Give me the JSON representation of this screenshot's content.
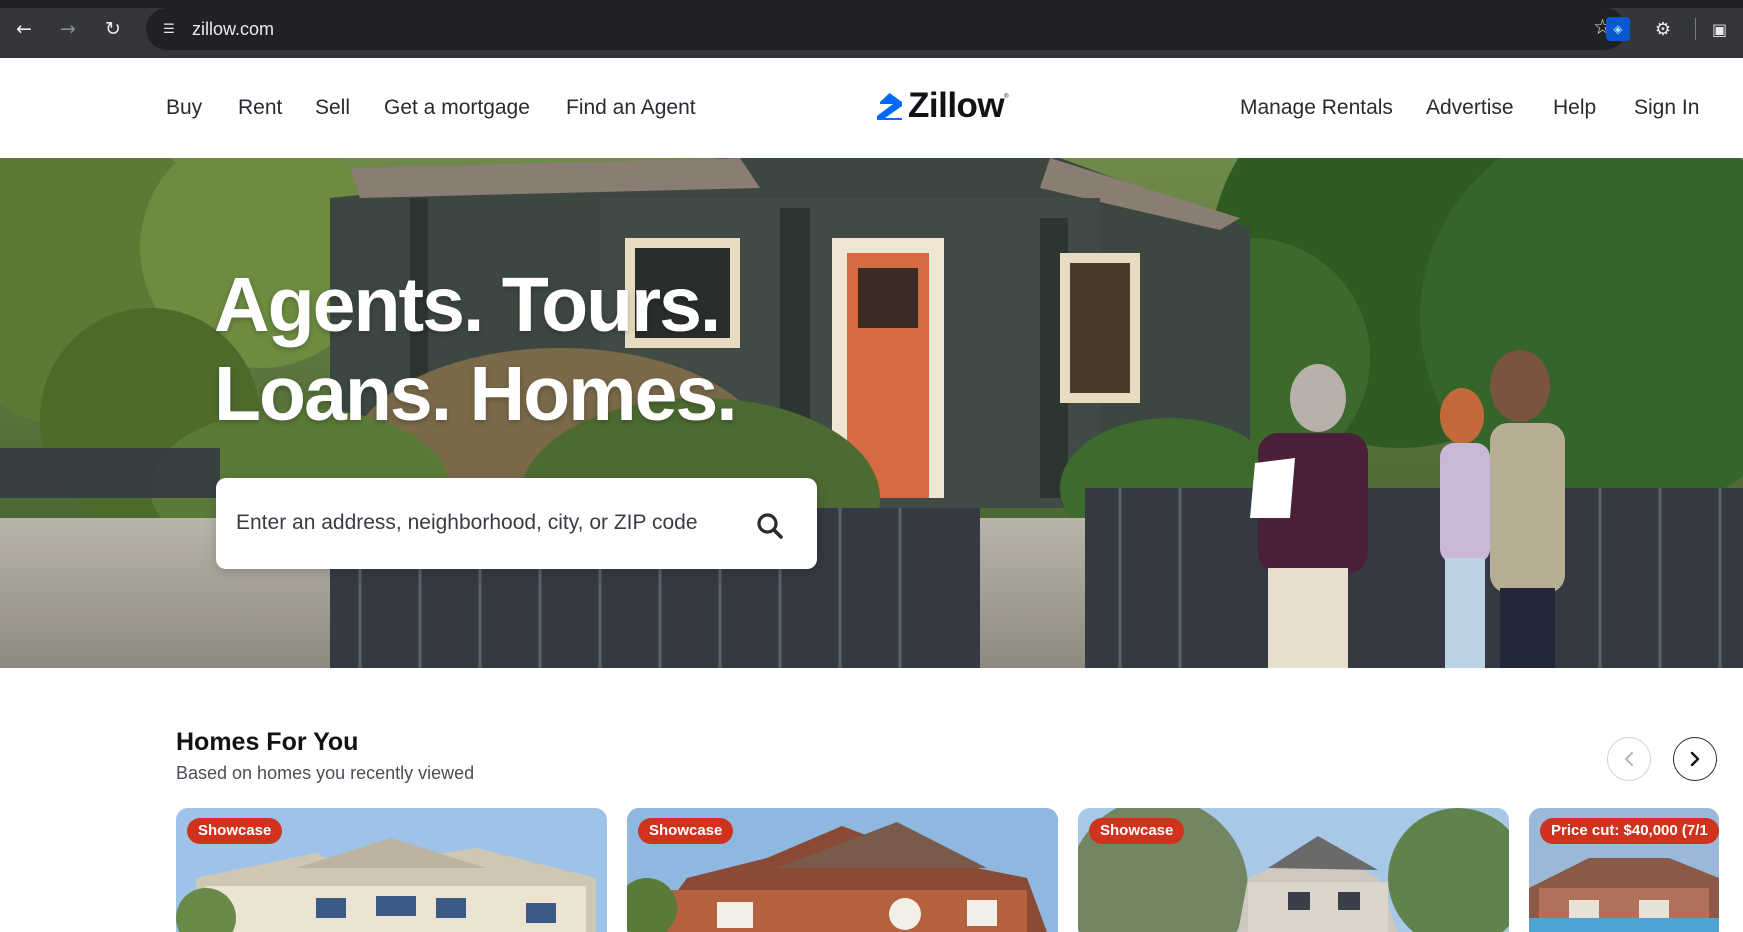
{
  "browser": {
    "url": "zillow.com",
    "back_icon": "arrow-left-icon",
    "forward_icon": "arrow-right-icon",
    "reload_icon": "reload-icon",
    "site_info_icon": "tune-icon",
    "bookmark_icon": "star-icon",
    "extensions_icon": "puzzle-icon"
  },
  "header": {
    "left_nav": [
      "Buy",
      "Rent",
      "Sell",
      "Get a mortgage",
      "Find an Agent"
    ],
    "logo_text": "Zillow",
    "right_nav": [
      "Manage Rentals",
      "Advertise",
      "Help",
      "Sign In"
    ]
  },
  "hero": {
    "title_line1": "Agents. Tours.",
    "title_line2": "Loans. Homes.",
    "search_placeholder": "Enter an address, neighborhood, city, or ZIP code",
    "search_icon": "search-icon"
  },
  "homes_for_you": {
    "title": "Homes For You",
    "subtitle": "Based on homes you recently viewed",
    "prev_icon": "chevron-left-icon",
    "next_icon": "chevron-right-icon",
    "cards": [
      {
        "badge": "Showcase"
      },
      {
        "badge": "Showcase"
      },
      {
        "badge": "Showcase"
      },
      {
        "badge": "Price cut: $40,000 (7/1"
      }
    ]
  },
  "colors": {
    "brand_blue": "#006aff",
    "badge_red": "#d0331d",
    "text_dark": "#2a2a33"
  }
}
